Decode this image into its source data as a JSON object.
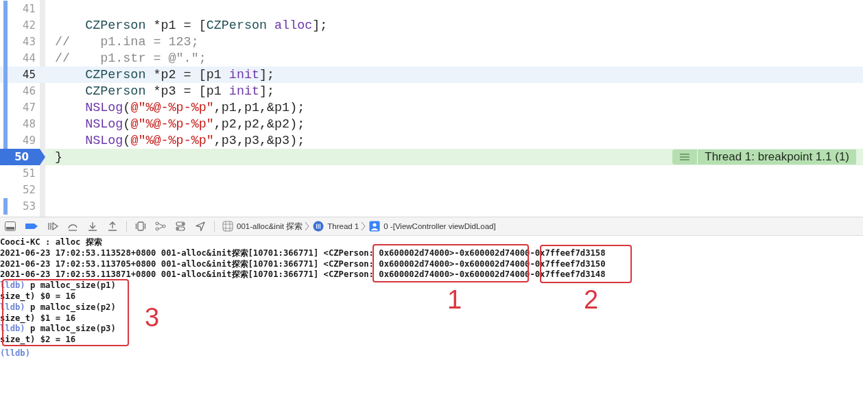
{
  "editor": {
    "lines": [
      {
        "number": "41",
        "changed": true,
        "highlighted": false,
        "breakpoint": false
      },
      {
        "number": "42",
        "changed": true,
        "highlighted": false,
        "breakpoint": false,
        "indented": true,
        "tokens": [
          {
            "kind": "class",
            "text": "CZPerson"
          },
          {
            "kind": "plain",
            "text": " *p1 = ["
          },
          {
            "kind": "class",
            "text": "CZPerson"
          },
          {
            "kind": "method",
            "text": " alloc"
          },
          {
            "kind": "plain",
            "text": "];"
          }
        ]
      },
      {
        "number": "43",
        "changed": true,
        "highlighted": false,
        "breakpoint": false,
        "indented": false,
        "tokens": [
          {
            "kind": "comment",
            "text": "//    p1.ina = 123;"
          }
        ]
      },
      {
        "number": "44",
        "changed": true,
        "highlighted": false,
        "breakpoint": false,
        "indented": false,
        "tokens": [
          {
            "kind": "comment",
            "text": "//    p1.str = @\".\";"
          }
        ]
      },
      {
        "number": "45",
        "changed": true,
        "highlighted": true,
        "breakpoint": false,
        "indented": true,
        "tokens": [
          {
            "kind": "class",
            "text": "CZPerson"
          },
          {
            "kind": "plain",
            "text": " *p2 = [p1"
          },
          {
            "kind": "method",
            "text": " init"
          },
          {
            "kind": "plain",
            "text": "];"
          }
        ]
      },
      {
        "number": "46",
        "changed": true,
        "highlighted": false,
        "breakpoint": false,
        "indented": true,
        "tokens": [
          {
            "kind": "class",
            "text": "CZPerson"
          },
          {
            "kind": "plain",
            "text": " *p3 = [p1"
          },
          {
            "kind": "method",
            "text": " init"
          },
          {
            "kind": "plain",
            "text": "];"
          }
        ]
      },
      {
        "number": "47",
        "changed": true,
        "highlighted": false,
        "breakpoint": false,
        "indented": true,
        "tokens": [
          {
            "kind": "method",
            "text": "NSLog"
          },
          {
            "kind": "plain",
            "text": "("
          },
          {
            "kind": "string",
            "text": "@\"%@-%p-%p\""
          },
          {
            "kind": "plain",
            "text": ",p1,p1,&p1);"
          }
        ]
      },
      {
        "number": "48",
        "changed": true,
        "highlighted": false,
        "breakpoint": false,
        "indented": true,
        "tokens": [
          {
            "kind": "method",
            "text": "NSLog"
          },
          {
            "kind": "plain",
            "text": "("
          },
          {
            "kind": "string",
            "text": "@\"%@-%p-%p\""
          },
          {
            "kind": "plain",
            "text": ",p2,p2,&p2);"
          }
        ]
      },
      {
        "number": "49",
        "changed": true,
        "highlighted": false,
        "breakpoint": false,
        "indented": true,
        "tokens": [
          {
            "kind": "method",
            "text": "NSLog"
          },
          {
            "kind": "plain",
            "text": "("
          },
          {
            "kind": "string",
            "text": "@\"%@-%p-%p\""
          },
          {
            "kind": "plain",
            "text": ",p3,p3,&p3);"
          }
        ]
      },
      {
        "number": "50",
        "changed": false,
        "highlighted": false,
        "breakpoint": true,
        "indented": false,
        "tokens": [
          {
            "kind": "plain",
            "text": "}"
          }
        ],
        "annotation": "Thread 1: breakpoint 1.1 (1)"
      },
      {
        "number": "51",
        "changed": false,
        "highlighted": false,
        "breakpoint": false
      },
      {
        "number": "52",
        "changed": false,
        "highlighted": false,
        "breakpoint": false
      },
      {
        "number": "53",
        "changed": true,
        "highlighted": false,
        "breakpoint": false
      }
    ]
  },
  "debug_bar": {
    "breakpoints_active": true,
    "breadcrumbs": [
      {
        "kind": "target",
        "label": "001-alloc&init 探索"
      },
      {
        "kind": "thread",
        "label": "Thread 1"
      },
      {
        "kind": "frame",
        "label": "0 -[ViewController viewDidLoad]"
      }
    ]
  },
  "console": {
    "lines": [
      {
        "kind": "output",
        "text": "Cooci-KC : alloc 探索"
      },
      {
        "kind": "output",
        "text": "2021-06-23 17:02:53.113528+0800 001-alloc&init探索[10701:366771] <CZPerson: 0x600002d74000>-0x600002d74000-0x7ffeef7d3158"
      },
      {
        "kind": "output",
        "text": "2021-06-23 17:02:53.113705+0800 001-alloc&init探索[10701:366771] <CZPerson: 0x600002d74000>-0x600002d74000-0x7ffeef7d3150"
      },
      {
        "kind": "output",
        "text": "2021-06-23 17:02:53.113871+0800 001-alloc&init探索[10701:366771] <CZPerson: 0x600002d74000>-0x600002d74000-0x7ffeef7d3148"
      },
      {
        "kind": "command",
        "prompt": "lldb)",
        "text": "p malloc_size(p1)"
      },
      {
        "kind": "output",
        "text": "size_t) $0 = 16"
      },
      {
        "kind": "command",
        "prompt": "lldb)",
        "text": "p malloc_size(p2)"
      },
      {
        "kind": "output",
        "text": "size_t) $1 = 16"
      },
      {
        "kind": "command",
        "prompt": "lldb)",
        "text": "p malloc_size(p3)"
      },
      {
        "kind": "output",
        "text": "size_t) $2 = 16"
      },
      {
        "kind": "command",
        "prompt": "(lldb)"
      }
    ],
    "annotations": [
      {
        "label": "1"
      },
      {
        "label": "2"
      },
      {
        "label": "3"
      }
    ]
  }
}
